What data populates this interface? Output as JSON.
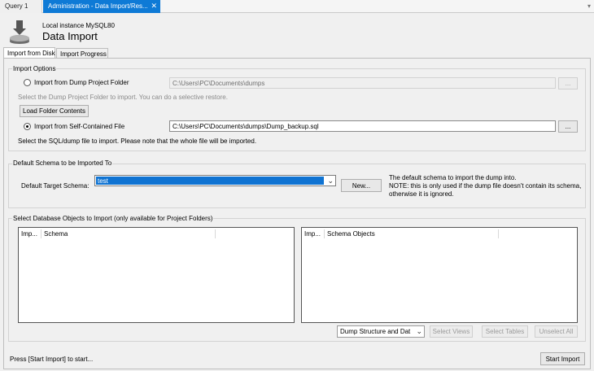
{
  "tabs": {
    "query": "Query 1",
    "admin": "Administration - Data Import/Res..."
  },
  "header": {
    "instance": "Local instance MySQL80",
    "title": "Data Import"
  },
  "inner_tabs": {
    "disk": "Import from Disk",
    "progress": "Import Progress"
  },
  "import_options": {
    "title": "Import Options",
    "folder_label": "Import from Dump Project Folder",
    "folder_path": "C:\\Users\\PC\\Documents\\dumps",
    "folder_hint": "Select the Dump Project Folder to import. You can do a selective restore.",
    "load_button": "Load Folder Contents",
    "file_label": "Import from Self-Contained File",
    "file_path": "C:\\Users\\PC\\Documents\\dumps\\Dump_backup.sql",
    "file_hint": "Select the SQL/dump file to import. Please note that the whole file will be imported.",
    "browse": "..."
  },
  "default_schema": {
    "title": "Default Schema to be Imported To",
    "label": "Default Target Schema:",
    "selected": "test",
    "new_button": "New...",
    "note1": "The default schema to import the dump into.",
    "note2": "NOTE: this is only used if the dump file doesn't contain its schema,",
    "note3": "otherwise it is ignored."
  },
  "objects": {
    "title": "Select Database Objects to Import (only available for Project Folders)",
    "left_col1": "Imp...",
    "left_col2": "Schema",
    "right_col1": "Imp...",
    "right_col2": "Schema Objects",
    "dump_select": "Dump Structure and Dat",
    "select_views": "Select Views",
    "select_tables": "Select Tables",
    "unselect_all": "Unselect All"
  },
  "footer": {
    "status": "Press [Start Import] to start...",
    "start_button": "Start Import"
  }
}
